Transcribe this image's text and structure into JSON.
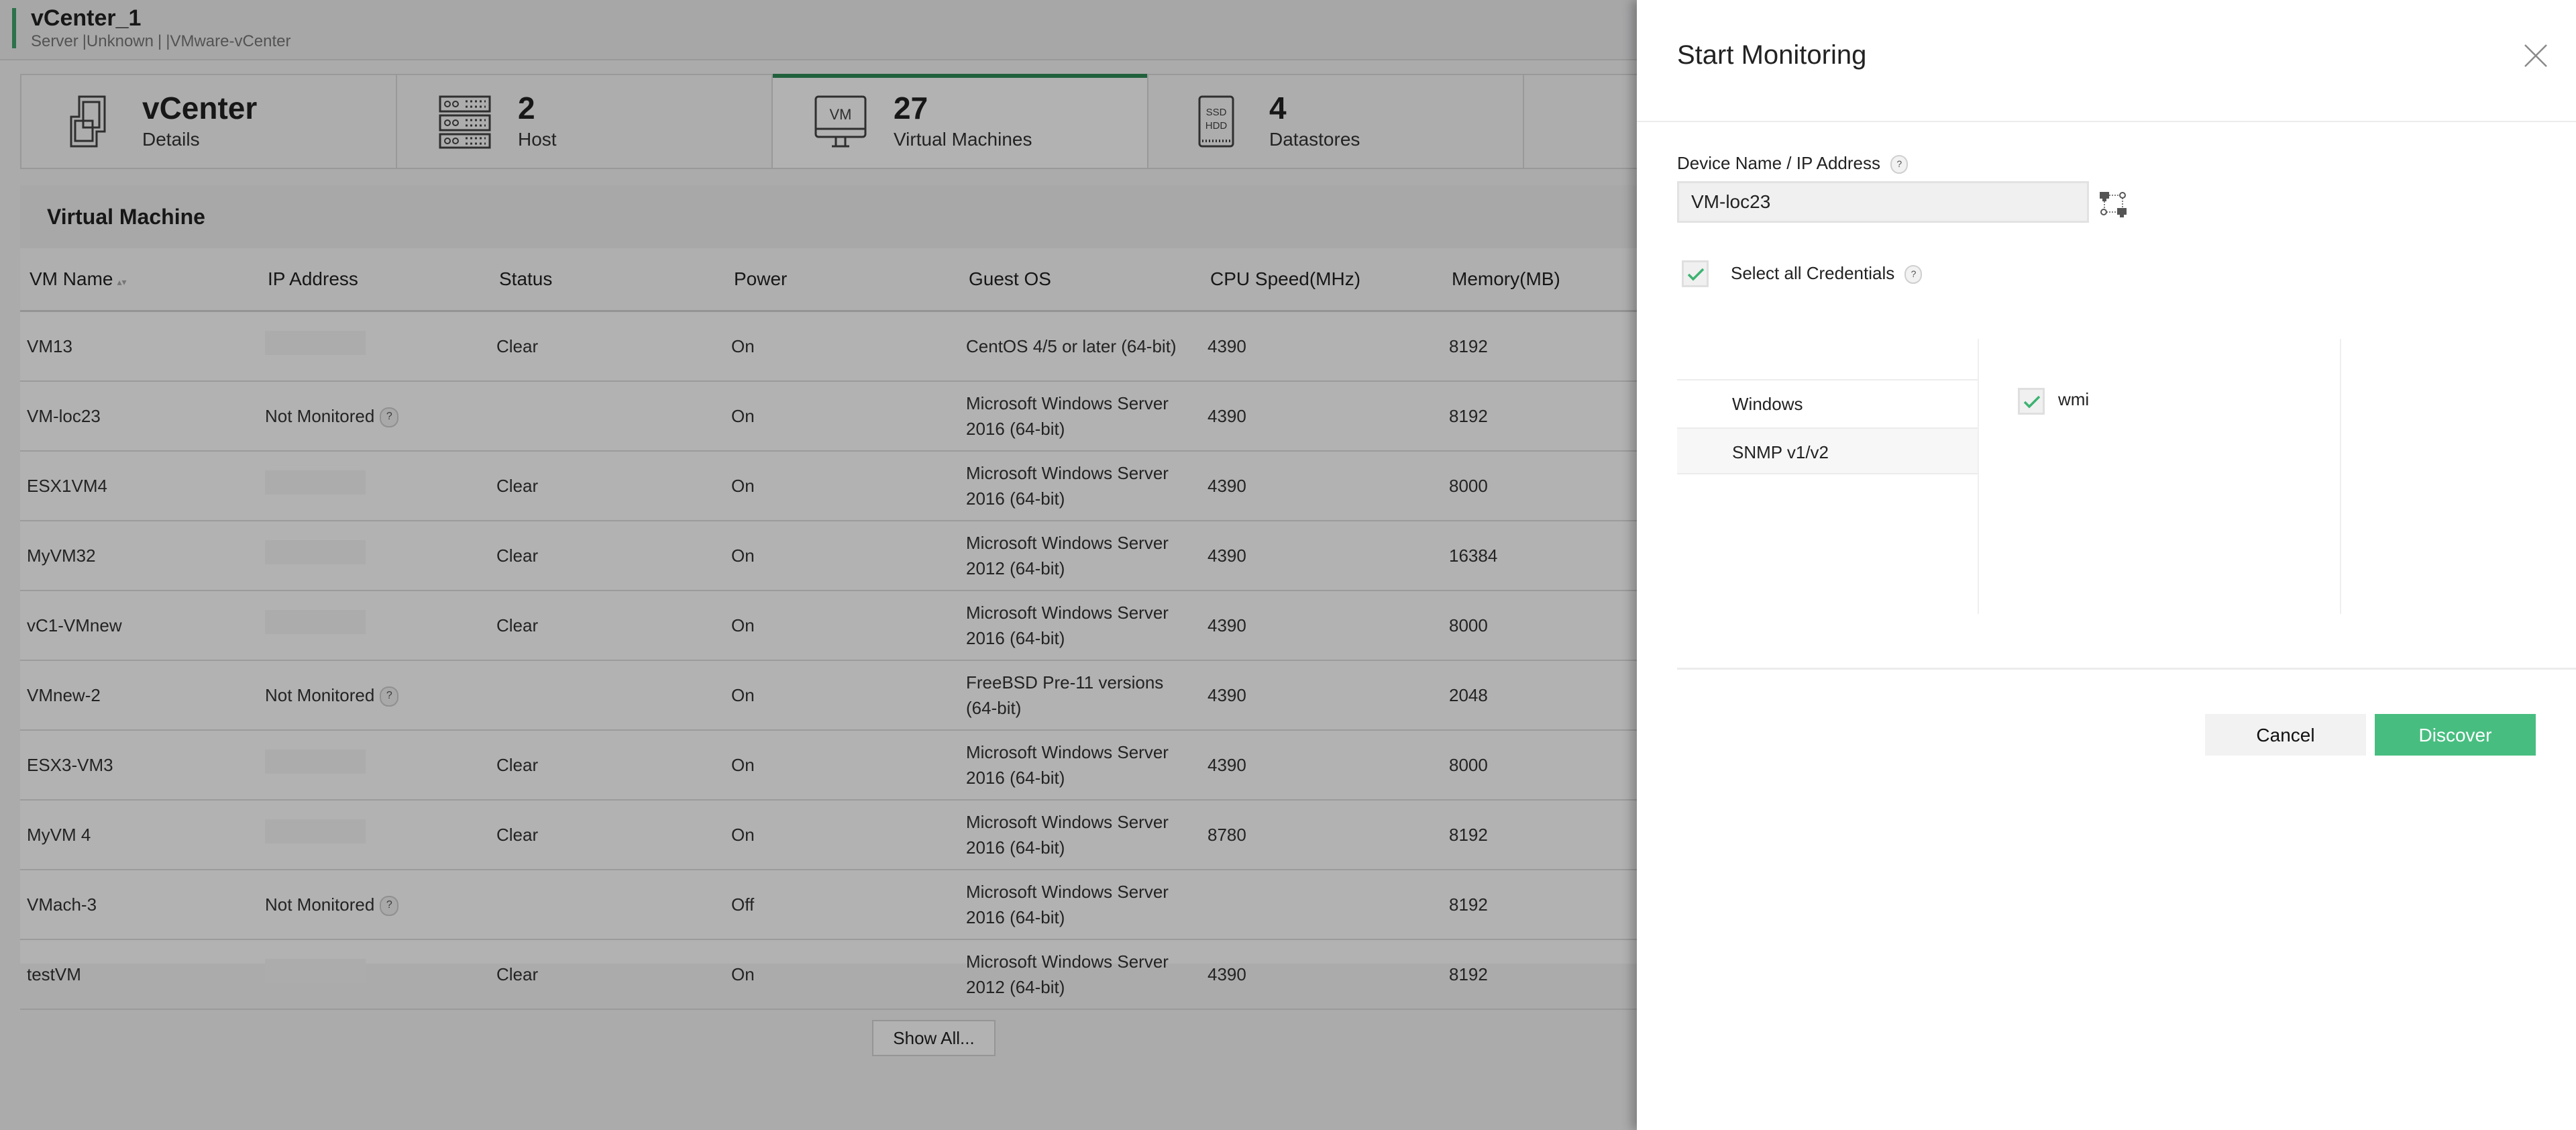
{
  "header": {
    "title": "vCenter_1",
    "subtitle_parts": [
      "Server",
      "|Unknown",
      "|",
      "|VMware-vCenter"
    ]
  },
  "tabs": [
    {
      "number": "vCenter",
      "label": "Details",
      "icon": "vcenter-icon",
      "active": false
    },
    {
      "number": "2",
      "label": "Host",
      "icon": "server-rack-icon",
      "active": false
    },
    {
      "number": "27",
      "label": "Virtual Machines",
      "icon": "vm-monitor-icon",
      "active": true
    },
    {
      "number": "4",
      "label": "Datastores",
      "icon": "ssd-hdd-icon",
      "active": false
    }
  ],
  "vm_section": {
    "title": "Virtual Machine",
    "columns": [
      "VM Name",
      "IP Address",
      "Status",
      "Power",
      "Guest OS",
      "CPU Speed(MHz)",
      "Memory(MB)"
    ],
    "rows": [
      {
        "name": "VM13",
        "ip": "",
        "ip_monitored": true,
        "status": "Clear",
        "power": "On",
        "guest_os": "CentOS 4/5 or later (64-bit)",
        "cpu": "4390",
        "memory": "8192"
      },
      {
        "name": "VM-loc23",
        "ip": "Not Monitored",
        "ip_monitored": false,
        "status": "",
        "power": "On",
        "guest_os": "Microsoft Windows Server 2016 (64-bit)",
        "cpu": "4390",
        "memory": "8192"
      },
      {
        "name": "ESX1VM4",
        "ip": "",
        "ip_monitored": true,
        "status": "Clear",
        "power": "On",
        "guest_os": "Microsoft Windows Server 2016 (64-bit)",
        "cpu": "4390",
        "memory": "8000"
      },
      {
        "name": "MyVM32",
        "ip": "",
        "ip_monitored": true,
        "status": "Clear",
        "power": "On",
        "guest_os": "Microsoft Windows Server 2012 (64-bit)",
        "cpu": "4390",
        "memory": "16384"
      },
      {
        "name": "vC1-VMnew",
        "ip": "",
        "ip_monitored": true,
        "status": "Clear",
        "power": "On",
        "guest_os": "Microsoft Windows Server 2016 (64-bit)",
        "cpu": "4390",
        "memory": "8000"
      },
      {
        "name": "VMnew-2",
        "ip": "Not Monitored",
        "ip_monitored": false,
        "status": "",
        "power": "On",
        "guest_os": "FreeBSD Pre-11 versions (64-bit)",
        "cpu": "4390",
        "memory": "2048"
      },
      {
        "name": "ESX3-VM3",
        "ip": "",
        "ip_monitored": true,
        "status": "Clear",
        "power": "On",
        "guest_os": "Microsoft Windows Server 2016 (64-bit)",
        "cpu": "4390",
        "memory": "8000"
      },
      {
        "name": "MyVM 4",
        "ip": "",
        "ip_monitored": true,
        "status": "Clear",
        "power": "On",
        "guest_os": "Microsoft Windows Server 2016 (64-bit)",
        "cpu": "8780",
        "memory": "8192"
      },
      {
        "name": "VMach-3",
        "ip": "Not Monitored",
        "ip_monitored": false,
        "status": "",
        "power": "Off",
        "guest_os": "Microsoft Windows Server 2016 (64-bit)",
        "cpu": "",
        "memory": "8192"
      },
      {
        "name": "testVM",
        "ip": "",
        "ip_monitored": true,
        "status": "Clear",
        "power": "On",
        "guest_os": "Microsoft Windows Server 2012 (64-bit)",
        "cpu": "4390",
        "memory": "8192"
      }
    ],
    "show_all_label": "Show All..."
  },
  "panel": {
    "title": "Start Monitoring",
    "device_label": "Device Name / IP Address",
    "help_glyph": "?",
    "device_value": "VM-loc23",
    "select_all_label": "Select all Credentials",
    "select_all_checked": true,
    "credential_types": [
      "Windows",
      "SNMP v1/v2"
    ],
    "credentials": [
      {
        "label": "wmi",
        "checked": true
      }
    ],
    "cancel_label": "Cancel",
    "discover_label": "Discover"
  },
  "colors": {
    "accent_green": "#2e8b57",
    "discover_green": "#47be80",
    "check_green": "#3cb371"
  }
}
